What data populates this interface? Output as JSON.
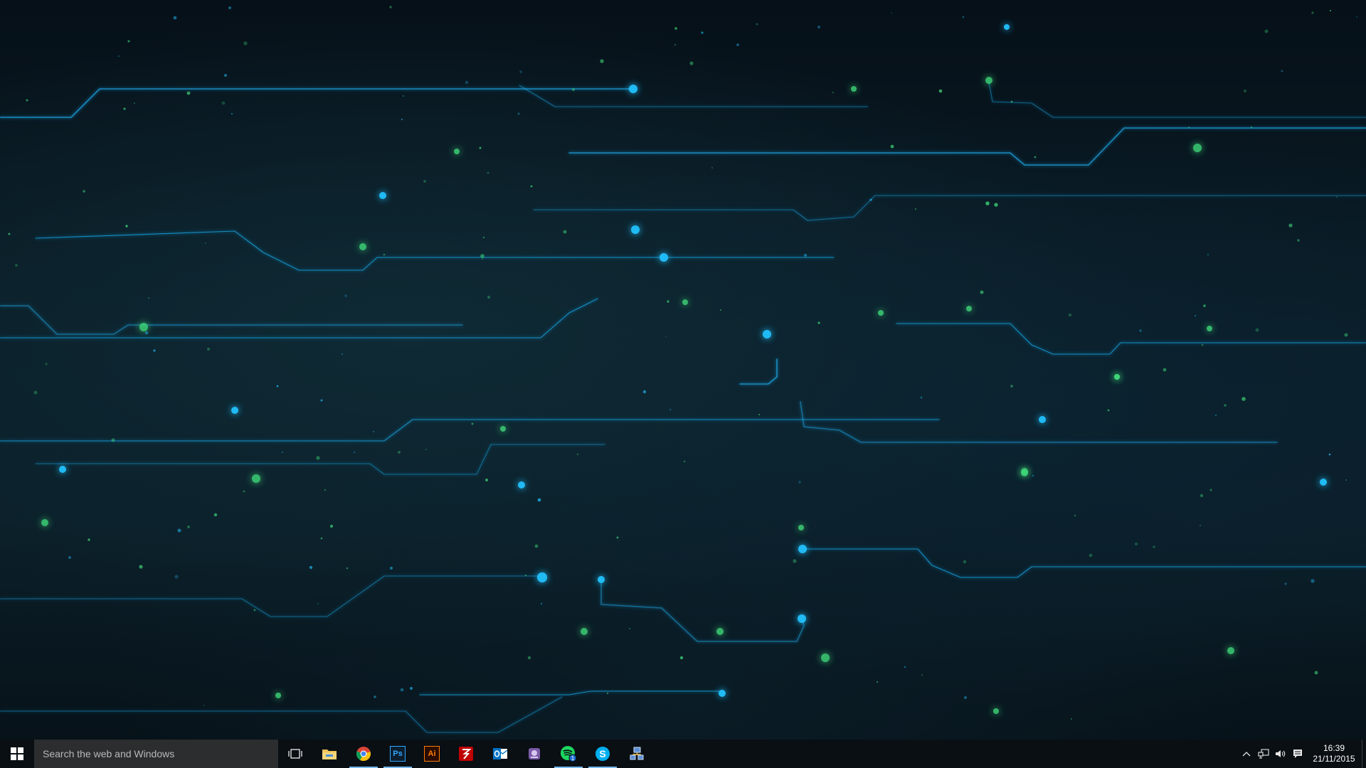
{
  "desktop": {
    "wallpaper": "circuit-lines",
    "colors": {
      "line": "#1aa6e6",
      "glow": "#22c3ff",
      "green": "#3fdc7a",
      "background": "#081620"
    }
  },
  "taskbar": {
    "start_icon": "windows-logo-icon",
    "search_placeholder": "Search the web and Windows",
    "task_view_icon": "task-view-icon",
    "apps": [
      {
        "name": "File Explorer",
        "icon": "folder-icon",
        "running": false
      },
      {
        "name": "Google Chrome",
        "icon": "chrome-icon",
        "running": true
      },
      {
        "name": "Adobe Photoshop",
        "icon": "photoshop-icon",
        "label": "Ps",
        "running": true
      },
      {
        "name": "Adobe Illustrator",
        "icon": "illustrator-icon",
        "label": "Ai",
        "running": false
      },
      {
        "name": "FileZilla",
        "icon": "filezilla-icon",
        "running": false
      },
      {
        "name": "Outlook",
        "icon": "outlook-icon",
        "running": false
      },
      {
        "name": "Settings Shortcut",
        "icon": "app-icon",
        "running": false
      },
      {
        "name": "Spotify",
        "icon": "spotify-icon",
        "badge": "1",
        "running": true
      },
      {
        "name": "Skype",
        "icon": "skype-icon",
        "running": true
      },
      {
        "name": "Network Tool",
        "icon": "network-icon",
        "running": false
      }
    ],
    "tray": {
      "chevron_icon": "chevron-up-icon",
      "network_icon": "network-icon",
      "volume_icon": "volume-icon",
      "notifications_icon": "action-center-icon",
      "time": "16:39",
      "date": "21/11/2015"
    }
  }
}
